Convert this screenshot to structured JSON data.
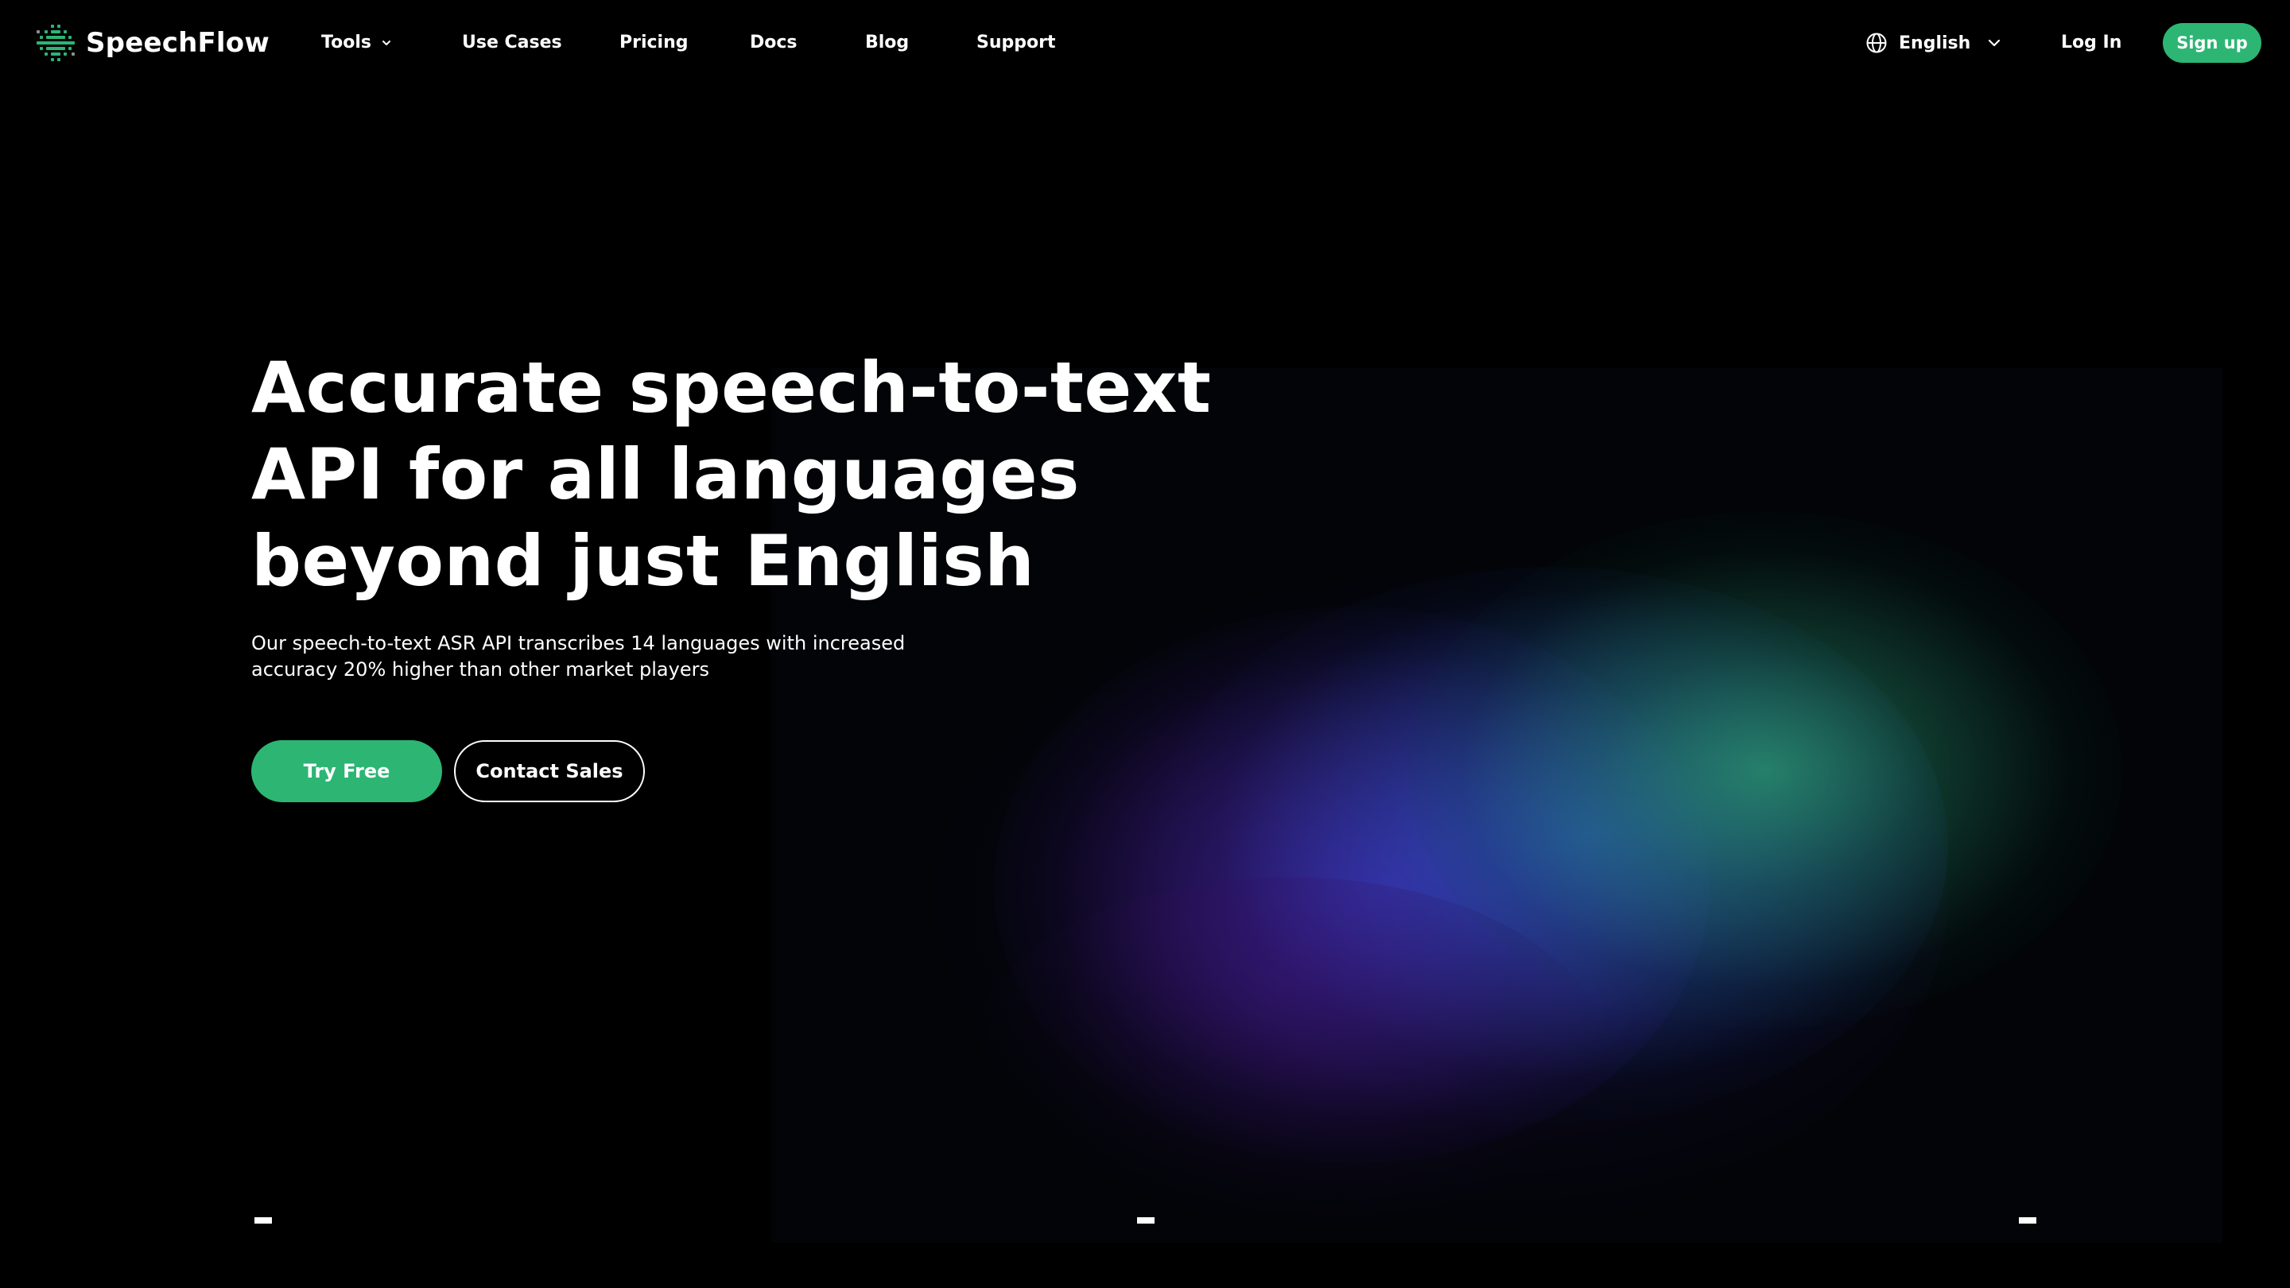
{
  "brand": {
    "name": "SpeechFlow",
    "logo_icon": "dotted-waveform-icon",
    "accent_color": "#2db574"
  },
  "nav": {
    "items": [
      {
        "label": "Tools",
        "has_dropdown": true
      },
      {
        "label": "Use Cases"
      },
      {
        "label": "Pricing"
      },
      {
        "label": "Docs"
      },
      {
        "label": "Blog"
      },
      {
        "label": "Support"
      }
    ],
    "language": {
      "icon": "globe-icon",
      "label": "English"
    },
    "login_label": "Log In",
    "signup_label": "Sign up"
  },
  "hero": {
    "title_lines": [
      "Accurate speech-to-text",
      "API for all languages",
      "beyond just English"
    ],
    "subtitle_lines": [
      "Our speech-to-text ASR API transcribes 14 languages with increased",
      "accuracy 20% higher than other market players"
    ],
    "primary_cta": "Try Free",
    "secondary_cta": "Contact Sales"
  }
}
